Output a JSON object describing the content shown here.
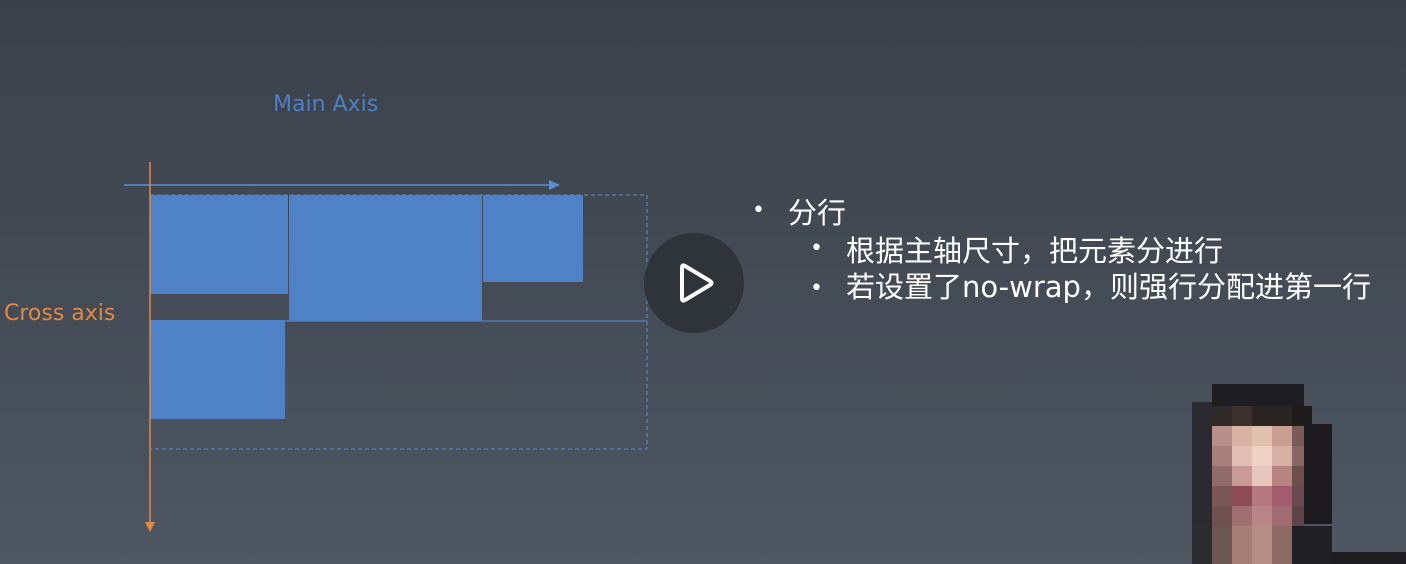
{
  "diagram": {
    "main_axis_label": "Main Axis",
    "cross_axis_label": "Cross axis",
    "colors": {
      "item_fill": "#4f81c7",
      "main_axis": "#5b8ed6",
      "cross_axis": "#e28a42",
      "line_box": "#5b8ed6"
    }
  },
  "slide": {
    "bullet_1": "分行",
    "bullet_1_sub": [
      "根据主轴尺寸，把元素分进行",
      "若设置了no-wrap，则强行分配进第一行"
    ]
  },
  "player": {
    "play_icon": "play-icon"
  },
  "presenter": {
    "avatar_icon": "pixelated-presenter-video"
  }
}
